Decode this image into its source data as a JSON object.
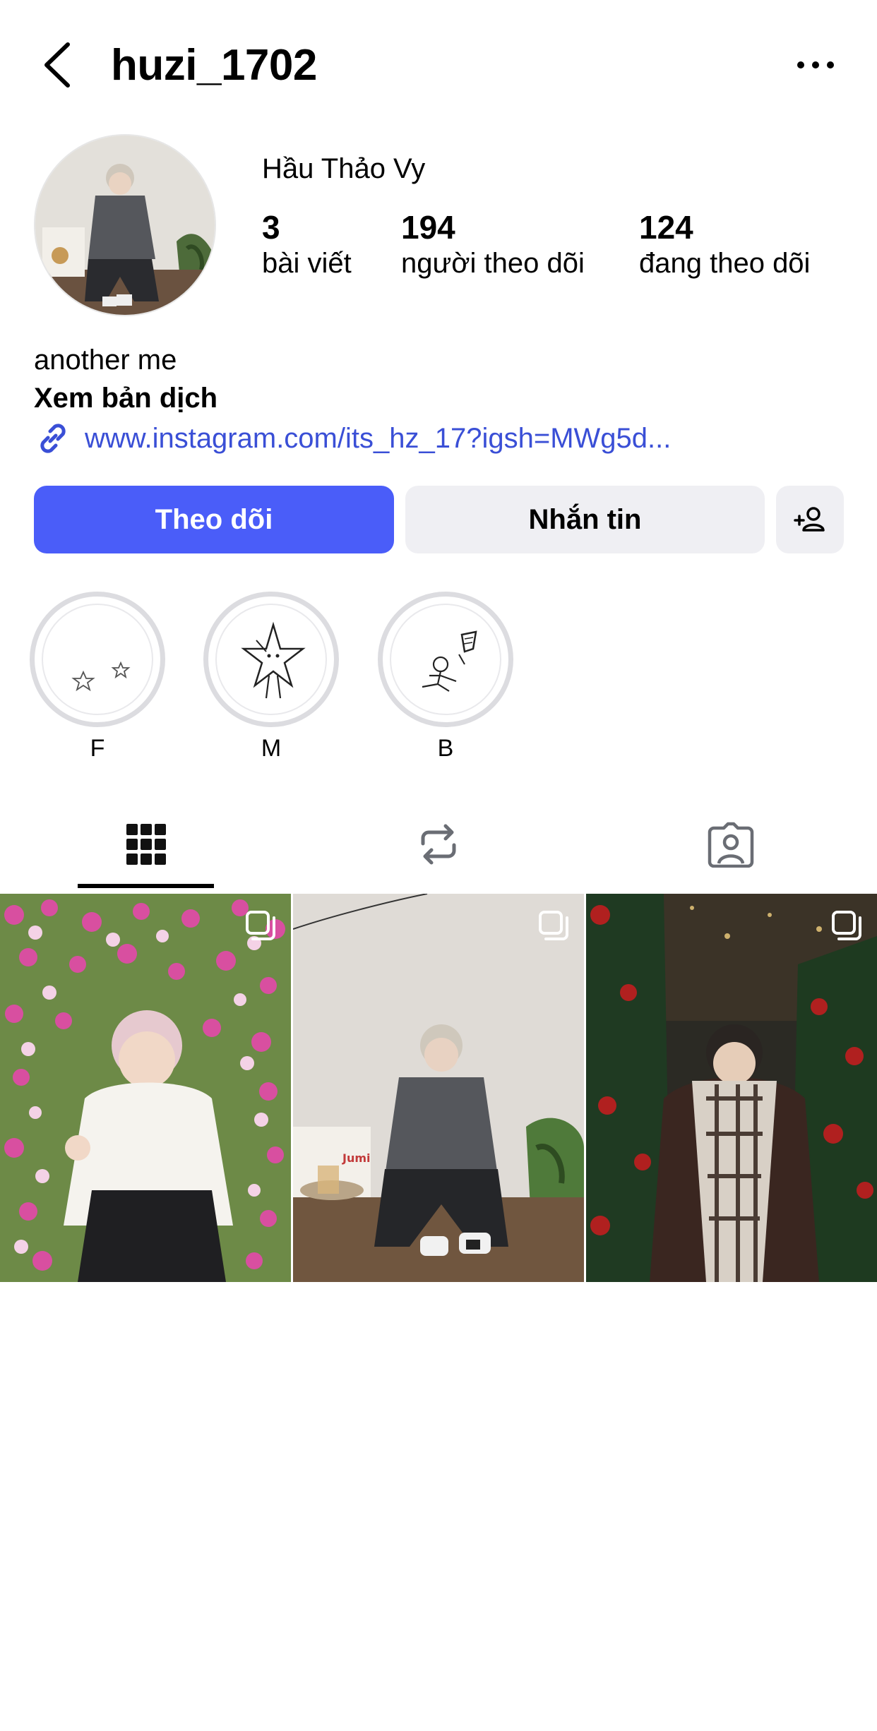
{
  "header": {
    "username": "huzi_1702",
    "back_icon": "chevron-left-icon",
    "more_icon": "ellipsis-icon"
  },
  "profile": {
    "display_name": "Hầu Thảo Vy",
    "stats": {
      "posts_count": "3",
      "posts_label": "bài viết",
      "followers_count": "194",
      "followers_label": "người theo dõi",
      "following_count": "124",
      "following_label": "đang theo dõi"
    },
    "bio": "another me",
    "translate_label": "Xem bản dịch",
    "link": "www.instagram.com/its_hz_17?igsh=MWg5d..."
  },
  "actions": {
    "follow_label": "Theo dõi",
    "message_label": "Nhắn tin",
    "add_user_icon": "add-user-icon"
  },
  "highlights": [
    {
      "label": "F"
    },
    {
      "label": "M"
    },
    {
      "label": "B"
    }
  ],
  "tabs": {
    "grid_icon": "grid-icon",
    "reposts_icon": "repost-icon",
    "tagged_icon": "tagged-person-icon",
    "active": "grid"
  },
  "colors": {
    "accent": "#4a5df9",
    "link": "#3a4fd6",
    "secondary_button": "#efeff3"
  }
}
